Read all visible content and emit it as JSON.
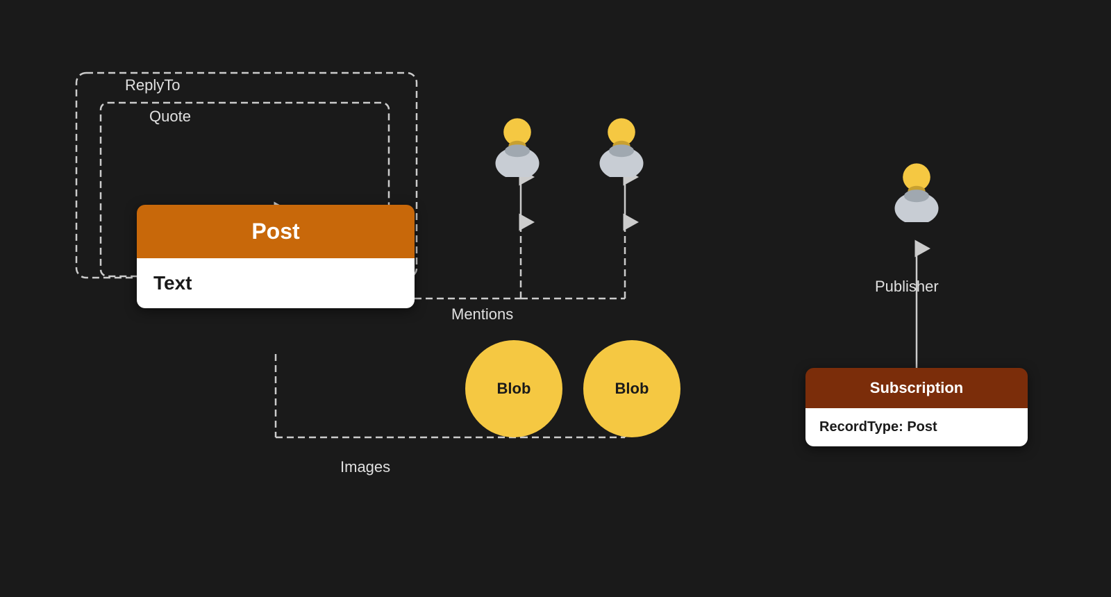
{
  "post": {
    "title": "Post",
    "body": "Text"
  },
  "subscription": {
    "title": "Subscription",
    "body": "RecordType: Post"
  },
  "labels": {
    "replyTo": "ReplyTo",
    "quote": "Quote",
    "mentions": "Mentions",
    "publisher": "Publisher",
    "images": "Images",
    "blob1": "Blob",
    "blob2": "Blob"
  },
  "colors": {
    "background": "#1a1a1a",
    "postHeader": "#c8680a",
    "subscriptionHeader": "#7b2d0a",
    "white": "#ffffff",
    "blobYellow": "#f5c842",
    "dashedLine": "#cccccc",
    "arrow": "#cccccc"
  }
}
